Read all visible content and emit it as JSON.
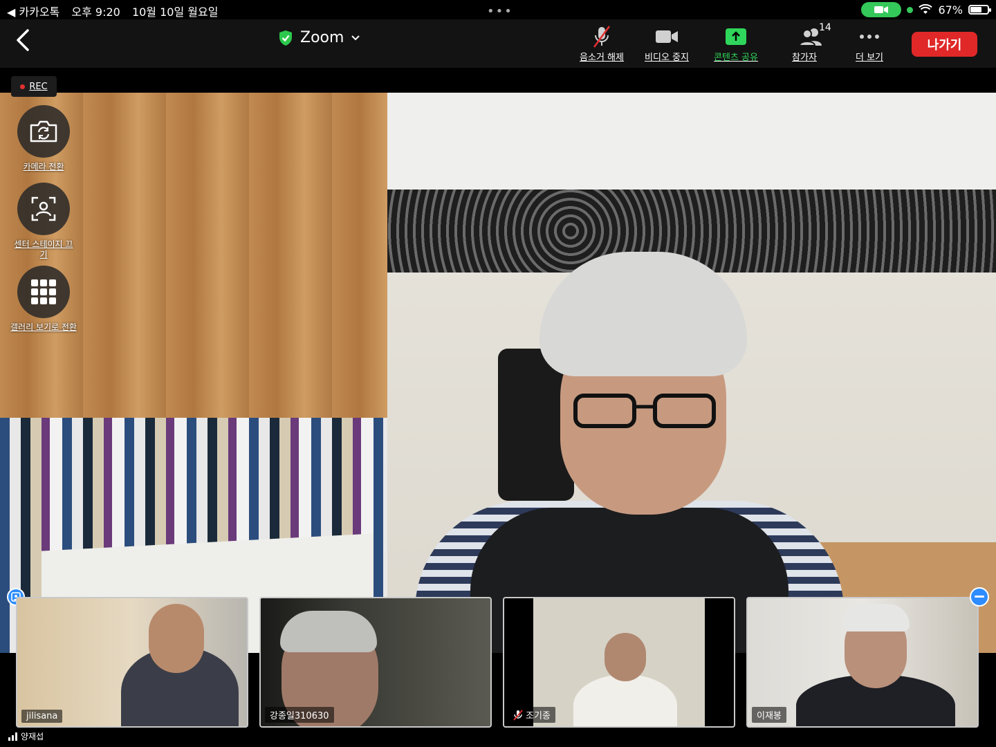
{
  "status_bar": {
    "back_app": "◀ 카카오톡",
    "time": "오후 9:20",
    "date": "10월 10일 월요일",
    "battery_percent": "67%",
    "battery_level": 0.67,
    "dots": "•••"
  },
  "toolbar": {
    "meeting_title": "Zoom",
    "unmute_label": "음소거 해제",
    "video_label": "비디오 중지",
    "share_label": "콘텐츠 공유",
    "participants_label": "참가자",
    "participants_count": "14",
    "more_label": "더 보기",
    "leave_label": "나가기"
  },
  "rec": {
    "label": "REC"
  },
  "side_controls": {
    "switch_camera": "카메라 전환",
    "center_stage": "센터 스테이지 끄기",
    "gallery_view": "갤러리 보기로 전환"
  },
  "thumbnails": [
    {
      "name": "jilisana",
      "muted": false
    },
    {
      "name": "강종일310630",
      "muted": false
    },
    {
      "name": "조기종",
      "muted": true
    },
    {
      "name": "이재봉",
      "muted": false
    }
  ],
  "bottom": {
    "active_speaker": "양재섭"
  },
  "colors": {
    "share_green": "#2fd65b",
    "leave_red": "#e02828",
    "accent_blue": "#2d8cff",
    "rec_red": "#e03030"
  }
}
